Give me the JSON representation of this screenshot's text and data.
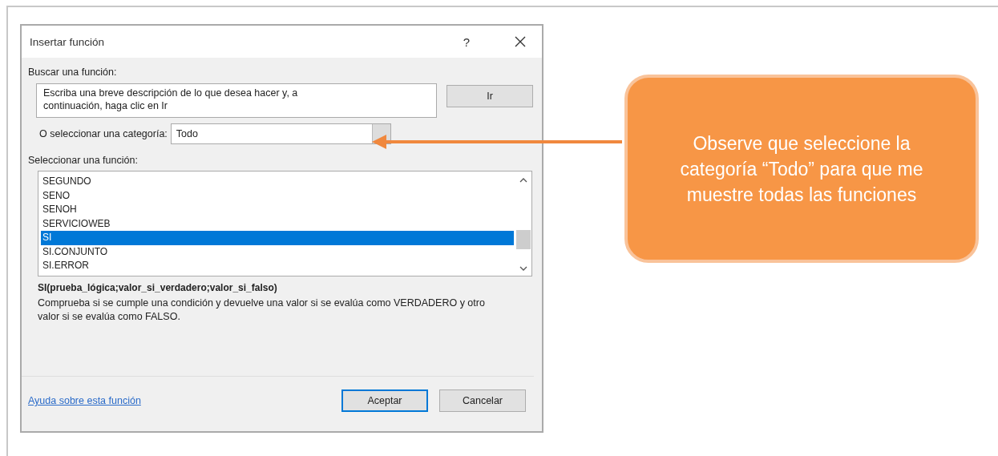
{
  "dialog": {
    "title": "Insertar función",
    "help_button": "?",
    "search": {
      "label": "Buscar una función:",
      "value": "Escriba una breve descripción de lo que desea hacer y, a continuación, haga clic en Ir",
      "go_button": "Ir"
    },
    "category": {
      "label": "O seleccionar una categoría:",
      "value": "Todo"
    },
    "function_list": {
      "label": "Seleccionar una función:",
      "items": [
        {
          "name": "SEGUNDO",
          "selected": false
        },
        {
          "name": "SENO",
          "selected": false
        },
        {
          "name": "SENOH",
          "selected": false
        },
        {
          "name": "SERVICIOWEB",
          "selected": false
        },
        {
          "name": "SI",
          "selected": true
        },
        {
          "name": "SI.CONJUNTO",
          "selected": false
        },
        {
          "name": "SI.ERROR",
          "selected": false
        }
      ]
    },
    "signature": "SI(prueba_lógica;valor_si_verdadero;valor_si_falso)",
    "description": "Comprueba si se cumple una condición y devuelve una valor si se evalúa como VERDADERO y otro valor si se evalúa como FALSO.",
    "help_link": "Ayuda sobre esta función",
    "buttons": [
      {
        "label": "Aceptar",
        "default": true
      },
      {
        "label": "Cancelar",
        "default": false
      }
    ]
  },
  "callout": {
    "text": "Observe que seleccione la categoría “Todo” para que me muestre todas las funciones"
  }
}
